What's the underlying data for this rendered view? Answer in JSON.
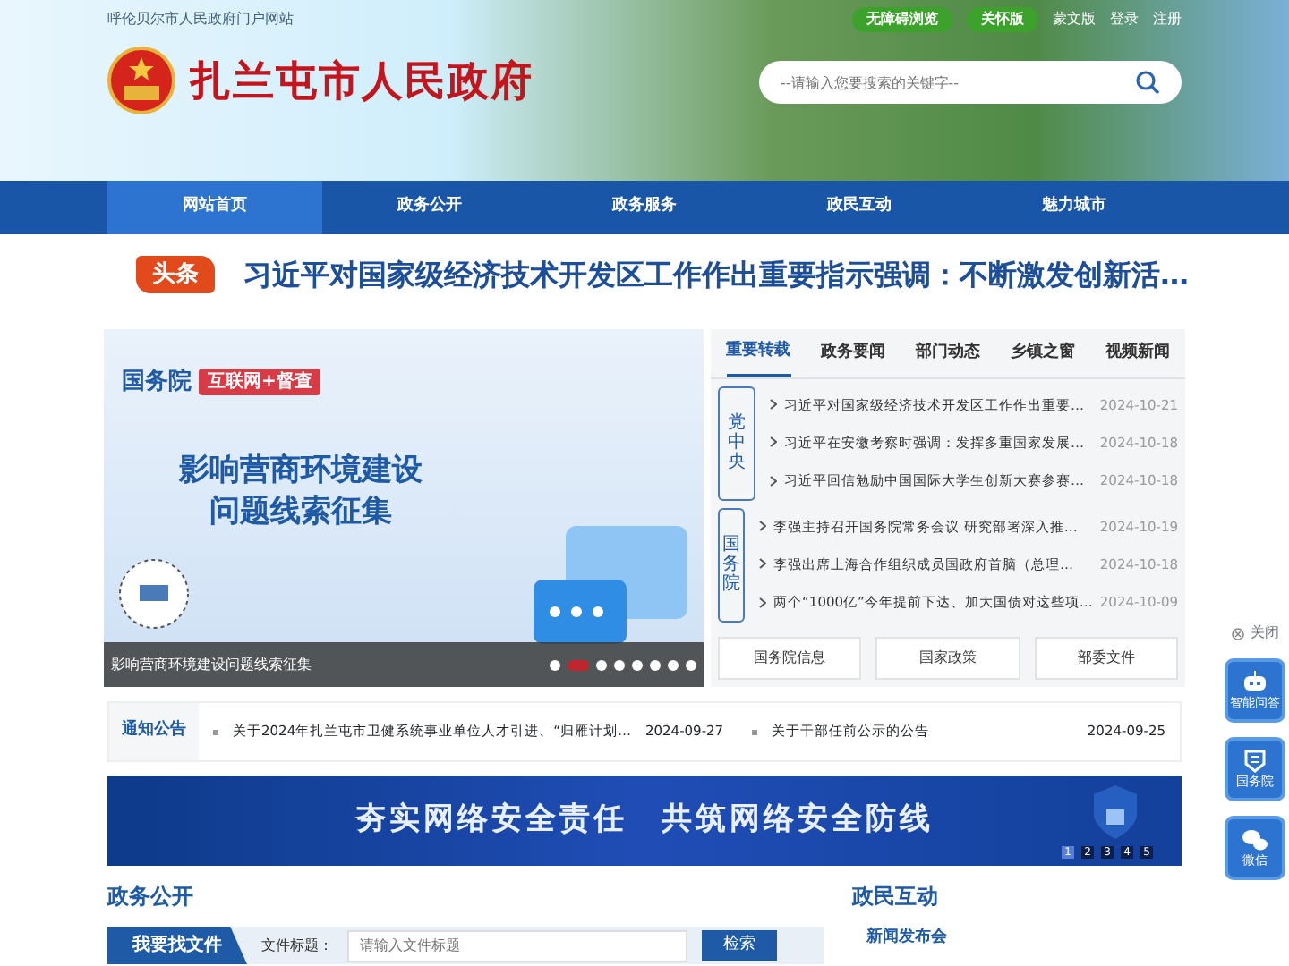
{
  "top_bar": {
    "portal_link": "呼伦贝尔市人民政府门户网站",
    "pill_buttons": [
      "无障碍浏览",
      "关怀版"
    ],
    "links": [
      "蒙文版",
      "登录",
      "注册"
    ]
  },
  "site_title": "扎兰屯市人民政府",
  "search": {
    "placeholder": "--请输入您要搜索的关键字--"
  },
  "nav": [
    {
      "label": "网站首页",
      "selected": true
    },
    {
      "label": "政务公开",
      "selected": false
    },
    {
      "label": "政务服务",
      "selected": false
    },
    {
      "label": "政民互动",
      "selected": false
    },
    {
      "label": "魅力城市",
      "selected": false
    }
  ],
  "headline": {
    "badge": "头条",
    "title": "习近平对国家级经济技术开发区工作作出重要指示强调：不断激发创新活…"
  },
  "slider": {
    "brand": "国务院",
    "tag": "互联网+督查",
    "heading_lines": [
      "影响营商环境建设",
      "问题线索征集"
    ],
    "caption": "影响营商环境建设问题线索征集",
    "dots": [
      {
        "selected": false
      },
      {
        "selected": true
      },
      {
        "selected": false
      },
      {
        "selected": false
      },
      {
        "selected": false
      },
      {
        "selected": false
      },
      {
        "selected": false
      },
      {
        "selected": false
      }
    ]
  },
  "news": {
    "tabs": [
      {
        "label": "重要转载",
        "selected": true
      },
      {
        "label": "政务要闻",
        "selected": false
      },
      {
        "label": "部门动态",
        "selected": false
      },
      {
        "label": "乡镇之窗",
        "selected": false
      },
      {
        "label": "视频新闻",
        "selected": false
      }
    ],
    "groups": [
      {
        "label": "党中央",
        "items": [
          {
            "title": "习近平对国家级经济技术开发区工作作出重要…",
            "date": "2024-10-21"
          },
          {
            "title": "习近平在安徽考察时强调：发挥多重国家发展…",
            "date": "2024-10-18"
          },
          {
            "title": "习近平回信勉励中国国际大学生创新大赛参赛…",
            "date": "2024-10-18"
          }
        ]
      },
      {
        "label": "国务院",
        "items": [
          {
            "title": "李强主持召开国务院常务会议 研究部署深入推…",
            "date": "2024-10-19"
          },
          {
            "title": "李强出席上海合作组织成员国政府首脑（总理…",
            "date": "2024-10-18"
          },
          {
            "title": "两个“1000亿”今年提前下达、加大国债对这些项…",
            "date": "2024-10-09"
          }
        ]
      }
    ],
    "buttons": [
      "国务院信息",
      "国家政策",
      "部委文件"
    ]
  },
  "notices": {
    "label": "通知公告",
    "items": [
      {
        "title": "关于2024年扎兰屯市卫健系统事业单位人才引进、“归雁计划…",
        "date": "2024-09-27"
      },
      {
        "title": "关于干部任前公示的公告",
        "date": "2024-09-25"
      }
    ]
  },
  "banner": {
    "text": "夯实网络安全责任　共筑网络安全防线",
    "pages": [
      {
        "label": "1",
        "selected": true
      },
      {
        "label": "2",
        "selected": false
      },
      {
        "label": "3",
        "selected": false
      },
      {
        "label": "4",
        "selected": false
      },
      {
        "label": "5",
        "selected": false
      }
    ]
  },
  "sections": {
    "left_title": "政务公开",
    "right_title": "政民互动",
    "file_search": {
      "tab": "我要找文件",
      "label": "文件标题：",
      "placeholder": "请输入文件标题",
      "button": "检索"
    },
    "right_item": "新闻发布会"
  },
  "side_widgets": {
    "close": "关闭",
    "buttons": [
      {
        "kind": "robot",
        "label": "智能问答"
      },
      {
        "kind": "council",
        "label": "国务院"
      },
      {
        "kind": "wechat",
        "label": "微信"
      }
    ]
  }
}
